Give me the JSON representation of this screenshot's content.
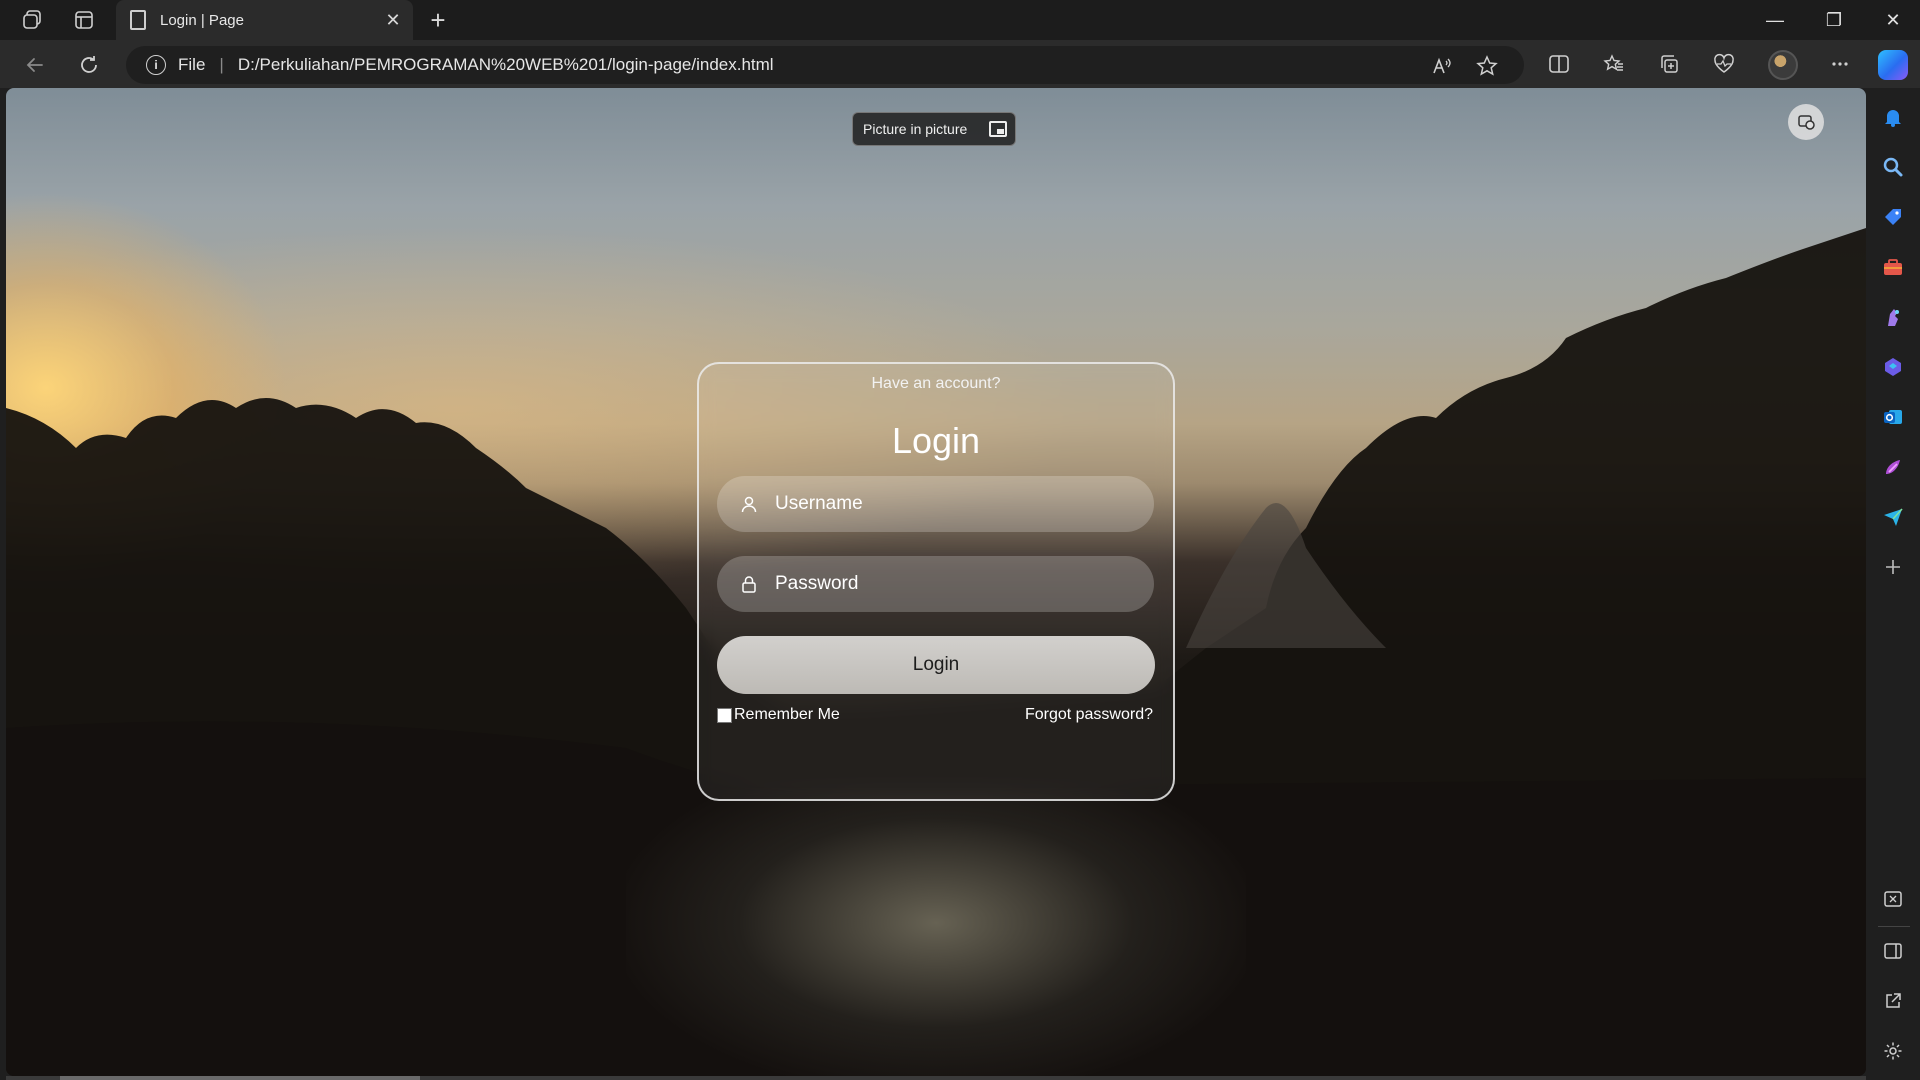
{
  "tab": {
    "title": "Login | Page",
    "close_glyph": "✕"
  },
  "newtab_glyph": "+",
  "window": {
    "minimize": "—",
    "restore": "❐",
    "close": "✕"
  },
  "address": {
    "scheme": "File",
    "separator": "|",
    "url": "D:/Perkuliahan/PEMROGRAMAN%20WEB%201/login-page/index.html"
  },
  "pip": {
    "label": "Picture in picture"
  },
  "login": {
    "subtitle": "Have an account?",
    "title": "Login",
    "username_placeholder": "Username",
    "password_placeholder": "Password",
    "button": "Login",
    "remember": "Remember Me",
    "forgot": "Forgot password?"
  },
  "icons": {
    "workspaces": "workspaces-icon",
    "tab_actions": "tab-actions-icon",
    "back": "back-icon",
    "refresh": "refresh-icon",
    "read_aloud": "read-aloud-icon",
    "favorite": "favorite-star-icon",
    "split": "split-screen-icon",
    "favorites": "favorites-icon",
    "collections": "collections-icon",
    "performance": "browser-essentials-icon",
    "more": "more-icon",
    "copilot": "copilot-icon"
  },
  "colors": {
    "accent_blue": "#2a8cf0",
    "page_bg": "#1f1f1f",
    "card_border": "#ebebeb"
  }
}
